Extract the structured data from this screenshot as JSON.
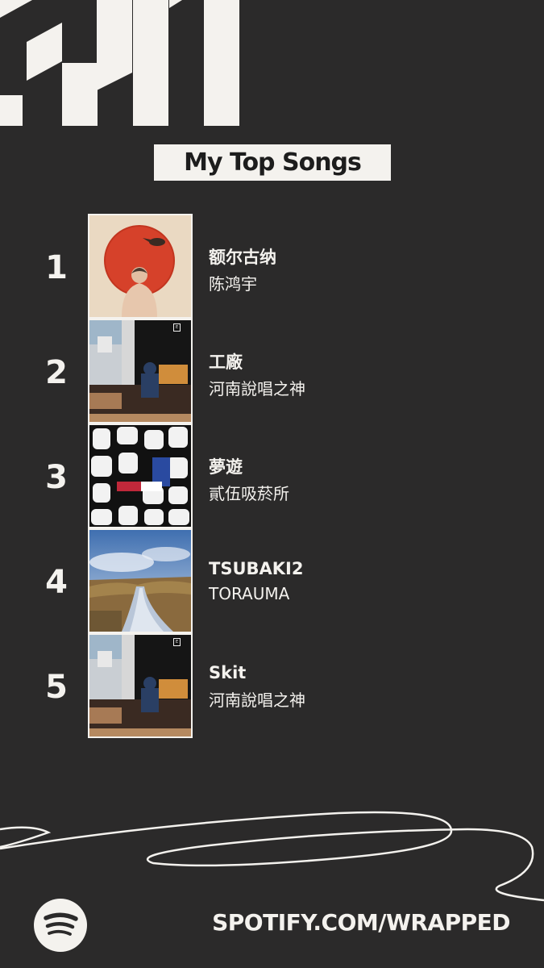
{
  "header": {
    "title": "My Top Songs"
  },
  "songs": [
    {
      "rank": "1",
      "title": "额尔古纳",
      "artist": "陈鸿宇",
      "cover_icon": "red-sun-album-art"
    },
    {
      "rank": "2",
      "title": "工廠",
      "artist": "河南說唱之神",
      "cover_icon": "rooftop-album-art"
    },
    {
      "rank": "3",
      "title": "夢遊",
      "artist": "貳伍吸菸所",
      "cover_icon": "black-white-pattern-album-art"
    },
    {
      "rank": "4",
      "title": "TSUBAKI2",
      "artist": "TORAUMA",
      "cover_icon": "river-sky-album-art"
    },
    {
      "rank": "5",
      "title": "Skit",
      "artist": "河南說唱之神",
      "cover_icon": "rooftop-album-art"
    }
  ],
  "footer": {
    "url": "SPOTIFY.COM/WRAPPED",
    "logo_icon": "spotify-logo-icon"
  },
  "colors": {
    "background": "#2b2a2a",
    "foreground": "#f4f2ee",
    "title_text": "#1d1d1d"
  }
}
